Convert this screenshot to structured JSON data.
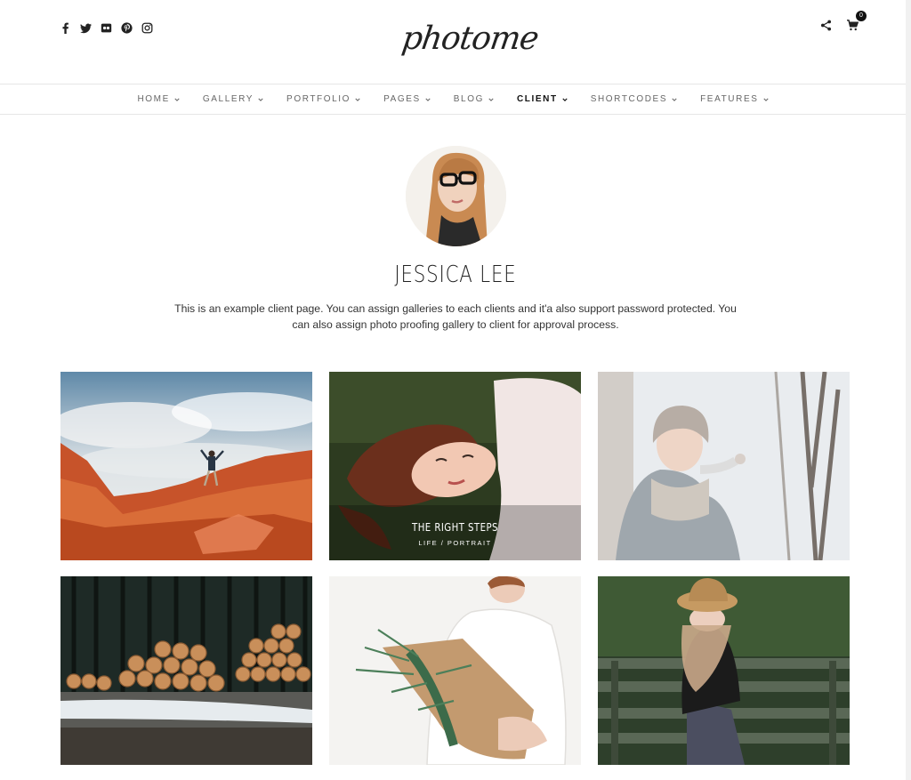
{
  "header": {
    "logo_text": "photome",
    "social_icons": [
      "facebook-icon",
      "twitter-icon",
      "flickr-icon",
      "pinterest-icon",
      "instagram-icon"
    ],
    "cart_count": "0"
  },
  "nav": {
    "items": [
      {
        "label": "HOME",
        "active": false
      },
      {
        "label": "GALLERY",
        "active": false
      },
      {
        "label": "PORTFOLIO",
        "active": false
      },
      {
        "label": "PAGES",
        "active": false
      },
      {
        "label": "BLOG",
        "active": false
      },
      {
        "label": "CLIENT",
        "active": true
      },
      {
        "label": "SHORTCODES",
        "active": false
      },
      {
        "label": "FEATURES",
        "active": false
      }
    ]
  },
  "client": {
    "name": "JESSICA LEE",
    "description": "This is an example client page. You can assign galleries to each clients and it'a also support password protected. You can also assign photo proofing gallery to client for approval process."
  },
  "gallery": {
    "items": [
      {
        "title": "",
        "subtitle": ""
      },
      {
        "title": "THE RIGHT STEPS",
        "subtitle": "LIFE / PORTRAIT"
      },
      {
        "title": "",
        "subtitle": ""
      },
      {
        "title": "",
        "subtitle": ""
      },
      {
        "title": "",
        "subtitle": ""
      },
      {
        "title": "",
        "subtitle": ""
      }
    ]
  },
  "colors": {
    "text_dark": "#222222",
    "nav_text": "#666666",
    "border": "#e6e6e6"
  }
}
